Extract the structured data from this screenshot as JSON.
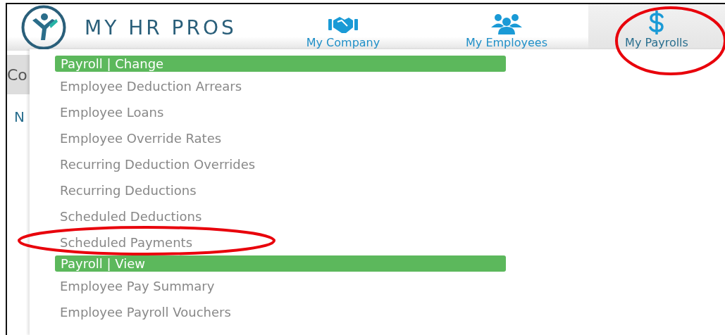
{
  "header": {
    "logo_text": "MY HR PROS",
    "nav": [
      {
        "label": "My Company",
        "selected": false
      },
      {
        "label": "My Employees",
        "selected": false
      },
      {
        "label": "My Payrolls",
        "selected": true
      }
    ]
  },
  "page_behind": {
    "title": "Co",
    "heading": "N"
  },
  "menu": {
    "sections": [
      {
        "title": "Payroll | Change",
        "items": [
          "Employee Deduction Arrears",
          "Employee Loans",
          "Employee Override Rates",
          "Recurring Deduction Overrides",
          "Recurring Deductions",
          "Scheduled Deductions",
          "Scheduled Payments"
        ]
      },
      {
        "title": "Payroll | View",
        "items": [
          "Employee Pay Summary",
          "Employee Payroll Vouchers"
        ]
      }
    ]
  }
}
